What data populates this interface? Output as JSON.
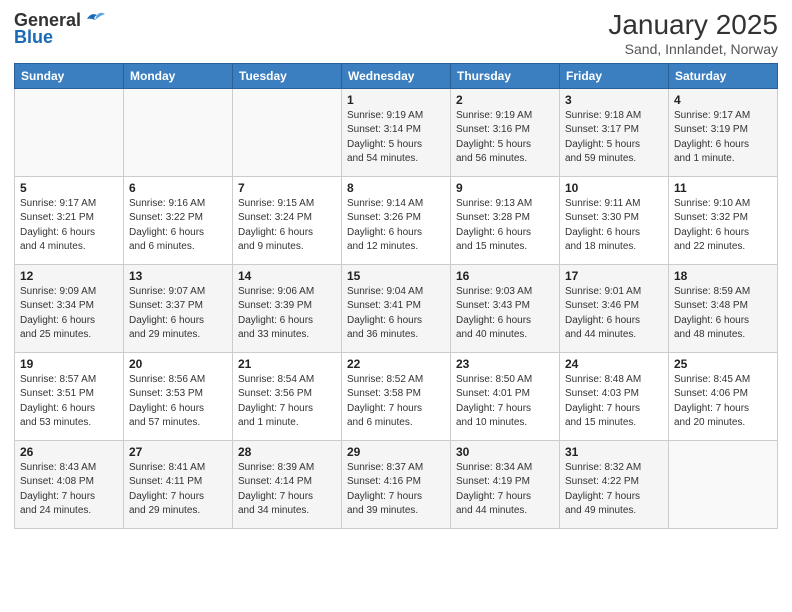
{
  "logo": {
    "general": "General",
    "blue": "Blue"
  },
  "title": "January 2025",
  "subtitle": "Sand, Innlandet, Norway",
  "days_of_week": [
    "Sunday",
    "Monday",
    "Tuesday",
    "Wednesday",
    "Thursday",
    "Friday",
    "Saturday"
  ],
  "weeks": [
    [
      {
        "day": "",
        "info": ""
      },
      {
        "day": "",
        "info": ""
      },
      {
        "day": "",
        "info": ""
      },
      {
        "day": "1",
        "info": "Sunrise: 9:19 AM\nSunset: 3:14 PM\nDaylight: 5 hours\nand 54 minutes."
      },
      {
        "day": "2",
        "info": "Sunrise: 9:19 AM\nSunset: 3:16 PM\nDaylight: 5 hours\nand 56 minutes."
      },
      {
        "day": "3",
        "info": "Sunrise: 9:18 AM\nSunset: 3:17 PM\nDaylight: 5 hours\nand 59 minutes."
      },
      {
        "day": "4",
        "info": "Sunrise: 9:17 AM\nSunset: 3:19 PM\nDaylight: 6 hours\nand 1 minute."
      }
    ],
    [
      {
        "day": "5",
        "info": "Sunrise: 9:17 AM\nSunset: 3:21 PM\nDaylight: 6 hours\nand 4 minutes."
      },
      {
        "day": "6",
        "info": "Sunrise: 9:16 AM\nSunset: 3:22 PM\nDaylight: 6 hours\nand 6 minutes."
      },
      {
        "day": "7",
        "info": "Sunrise: 9:15 AM\nSunset: 3:24 PM\nDaylight: 6 hours\nand 9 minutes."
      },
      {
        "day": "8",
        "info": "Sunrise: 9:14 AM\nSunset: 3:26 PM\nDaylight: 6 hours\nand 12 minutes."
      },
      {
        "day": "9",
        "info": "Sunrise: 9:13 AM\nSunset: 3:28 PM\nDaylight: 6 hours\nand 15 minutes."
      },
      {
        "day": "10",
        "info": "Sunrise: 9:11 AM\nSunset: 3:30 PM\nDaylight: 6 hours\nand 18 minutes."
      },
      {
        "day": "11",
        "info": "Sunrise: 9:10 AM\nSunset: 3:32 PM\nDaylight: 6 hours\nand 22 minutes."
      }
    ],
    [
      {
        "day": "12",
        "info": "Sunrise: 9:09 AM\nSunset: 3:34 PM\nDaylight: 6 hours\nand 25 minutes."
      },
      {
        "day": "13",
        "info": "Sunrise: 9:07 AM\nSunset: 3:37 PM\nDaylight: 6 hours\nand 29 minutes."
      },
      {
        "day": "14",
        "info": "Sunrise: 9:06 AM\nSunset: 3:39 PM\nDaylight: 6 hours\nand 33 minutes."
      },
      {
        "day": "15",
        "info": "Sunrise: 9:04 AM\nSunset: 3:41 PM\nDaylight: 6 hours\nand 36 minutes."
      },
      {
        "day": "16",
        "info": "Sunrise: 9:03 AM\nSunset: 3:43 PM\nDaylight: 6 hours\nand 40 minutes."
      },
      {
        "day": "17",
        "info": "Sunrise: 9:01 AM\nSunset: 3:46 PM\nDaylight: 6 hours\nand 44 minutes."
      },
      {
        "day": "18",
        "info": "Sunrise: 8:59 AM\nSunset: 3:48 PM\nDaylight: 6 hours\nand 48 minutes."
      }
    ],
    [
      {
        "day": "19",
        "info": "Sunrise: 8:57 AM\nSunset: 3:51 PM\nDaylight: 6 hours\nand 53 minutes."
      },
      {
        "day": "20",
        "info": "Sunrise: 8:56 AM\nSunset: 3:53 PM\nDaylight: 6 hours\nand 57 minutes."
      },
      {
        "day": "21",
        "info": "Sunrise: 8:54 AM\nSunset: 3:56 PM\nDaylight: 7 hours\nand 1 minute."
      },
      {
        "day": "22",
        "info": "Sunrise: 8:52 AM\nSunset: 3:58 PM\nDaylight: 7 hours\nand 6 minutes."
      },
      {
        "day": "23",
        "info": "Sunrise: 8:50 AM\nSunset: 4:01 PM\nDaylight: 7 hours\nand 10 minutes."
      },
      {
        "day": "24",
        "info": "Sunrise: 8:48 AM\nSunset: 4:03 PM\nDaylight: 7 hours\nand 15 minutes."
      },
      {
        "day": "25",
        "info": "Sunrise: 8:45 AM\nSunset: 4:06 PM\nDaylight: 7 hours\nand 20 minutes."
      }
    ],
    [
      {
        "day": "26",
        "info": "Sunrise: 8:43 AM\nSunset: 4:08 PM\nDaylight: 7 hours\nand 24 minutes."
      },
      {
        "day": "27",
        "info": "Sunrise: 8:41 AM\nSunset: 4:11 PM\nDaylight: 7 hours\nand 29 minutes."
      },
      {
        "day": "28",
        "info": "Sunrise: 8:39 AM\nSunset: 4:14 PM\nDaylight: 7 hours\nand 34 minutes."
      },
      {
        "day": "29",
        "info": "Sunrise: 8:37 AM\nSunset: 4:16 PM\nDaylight: 7 hours\nand 39 minutes."
      },
      {
        "day": "30",
        "info": "Sunrise: 8:34 AM\nSunset: 4:19 PM\nDaylight: 7 hours\nand 44 minutes."
      },
      {
        "day": "31",
        "info": "Sunrise: 8:32 AM\nSunset: 4:22 PM\nDaylight: 7 hours\nand 49 minutes."
      },
      {
        "day": "",
        "info": ""
      }
    ]
  ]
}
